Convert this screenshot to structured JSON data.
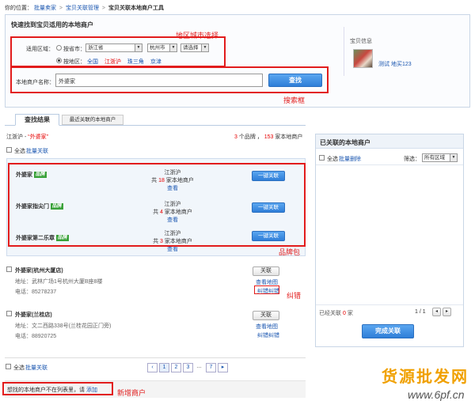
{
  "breadcrumb": {
    "prefix": "你的位置：",
    "items": [
      "批量卖家",
      "宝贝关联管理",
      "宝贝关联本地商户工具"
    ],
    "sep": ">"
  },
  "search_panel": {
    "title": "快速找到宝贝适用的本地商户",
    "region_label": "适用区域：",
    "radio_city_label": "按省市：",
    "province": "浙江省",
    "city": "杭州市",
    "district": "请选择",
    "radio_area_label": "按地区：",
    "areas": [
      "全国",
      "江浙沪",
      "珠三角",
      "京津"
    ],
    "merchant_label": "本地商户名称：",
    "merchant_value": "外婆家",
    "search_button": "查找"
  },
  "product_info": {
    "title": "宝贝信息",
    "name": "测试 地买123"
  },
  "annotations": {
    "region": "地区城市选择",
    "search": "搜索框",
    "brand": "品牌包",
    "correct": "纠错",
    "add": "新增商户"
  },
  "tabs": [
    "查找结果",
    "最近关联的本地商户"
  ],
  "results": {
    "scope": "江浙沪 - ",
    "keyword": "“外婆家”",
    "summary_pre": "3",
    "summary_mid": " 个品牌 ， ",
    "summary_count": "153",
    "summary_post": " 家本地商户",
    "select_all": "全选",
    "batch_link": "批量关联"
  },
  "brands": [
    {
      "name": "外婆家",
      "badge": "品牌",
      "region": "江浙沪",
      "count_pre": "共",
      "count": "18",
      "count_post": "家本地商户",
      "view": "查看",
      "button": "一键关联"
    },
    {
      "name": "外婆家指尖门",
      "badge": "品牌",
      "region": "江浙沪",
      "count_pre": "共",
      "count": "4",
      "count_post": "家本地商户",
      "view": "查看",
      "button": "一键关联"
    },
    {
      "name": "外婆家第二乐章",
      "badge": "品牌",
      "region": "江浙沪",
      "count_pre": "共",
      "count": "3",
      "count_post": "家本地商户",
      "view": "查看",
      "button": "一键关联"
    }
  ],
  "stores": [
    {
      "name": "外婆家(杭州大厦店)",
      "addr_label": "地址：",
      "addr": "武林广场1号杭州大厦B座8楼",
      "tel_label": "电话：",
      "tel": "85278237",
      "button": "关联",
      "map": "查看地图",
      "correct": "纠错纠错"
    },
    {
      "name": "外婆家(兰桂店)",
      "addr_label": "地址：",
      "addr": "文二西路338号(兰桂花园正门旁)",
      "tel_label": "电话：",
      "tel": "88920725",
      "button": "关联",
      "map": "查看地图",
      "correct": "纠错纠错"
    }
  ],
  "footer": {
    "select_all": "全选",
    "batch_link": "批量关联",
    "pages": [
      "1",
      "2",
      "3",
      "…",
      "7"
    ],
    "not_found": "想找的本地商户不在列表里，请",
    "add_link": "添加"
  },
  "linked_panel": {
    "title": "已关联的本地商户",
    "select_all": "全选",
    "batch_delete": "批量删除",
    "filter_label": "筛选：",
    "filter_value": "所有区域",
    "count_pre": "已经关联",
    "count": "0",
    "count_post": "家",
    "page": "1 / 1",
    "finish_button": "完成关联"
  },
  "watermark": {
    "text": "货源批发网",
    "site": "www.6pf.cn"
  },
  "colors": {
    "link": "#1a56b0",
    "annotation": "#e21c1c",
    "badge": "#3aa23a",
    "accent": "#e60000"
  }
}
